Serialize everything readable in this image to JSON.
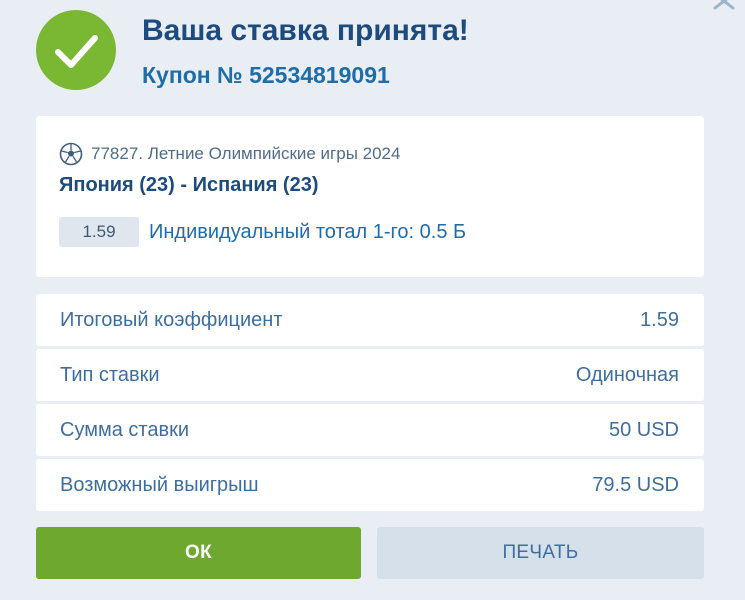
{
  "header": {
    "title": "Ваша ставка принята!",
    "coupon": "Купон № 52534819091"
  },
  "event": {
    "line": "77827. Летние Олимпийские игры 2024",
    "match": "Япония (23) - Испания (23)",
    "odds": "1.59",
    "market": "Индивидуальный тотал 1-го: 0.5 Б"
  },
  "summary": [
    {
      "label": "Итоговый коэффициент",
      "value": "1.59"
    },
    {
      "label": "Тип ставки",
      "value": "Одиночная"
    },
    {
      "label": "Сумма ставки",
      "value": "50 USD"
    },
    {
      "label": "Возможный выигрыш",
      "value": "79.5 USD"
    }
  ],
  "buttons": {
    "ok": "ОК",
    "print": "ПЕЧАТЬ"
  },
  "icons": {
    "close": "close-icon",
    "success": "checkmark-icon",
    "sport": "soccer-ball-icon"
  },
  "colors": {
    "accent_green": "#6fa82e",
    "title_blue": "#1d4b7d",
    "link_blue": "#1e6ca8",
    "background": "#e9eef4"
  }
}
